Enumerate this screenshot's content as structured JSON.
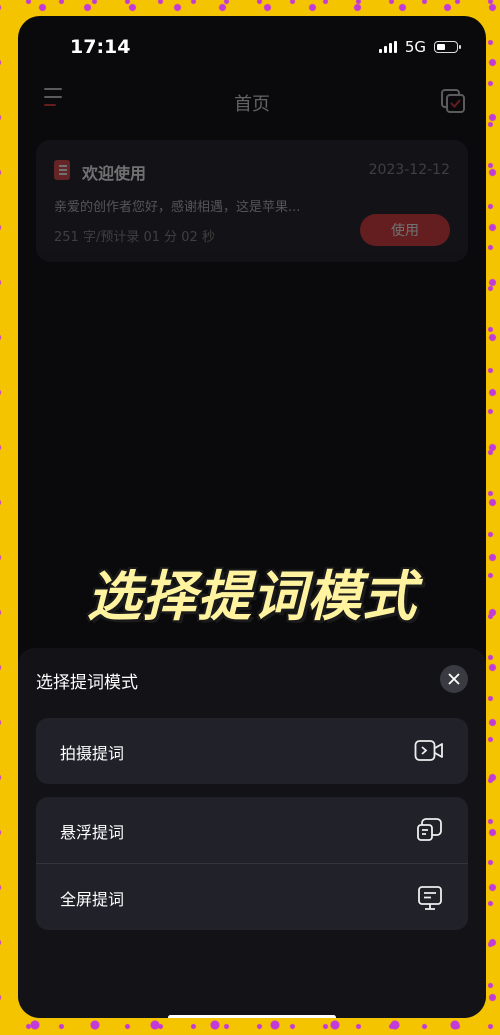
{
  "status": {
    "time": "17:14",
    "network": "5G"
  },
  "nav": {
    "title": "首页"
  },
  "card": {
    "title": "欢迎使用",
    "date": "2023-12-12",
    "description": "亲爱的创作者您好，感谢相遇，这是苹果...",
    "meta": "251 字/预计录 01 分 02 秒",
    "use_label": "使用"
  },
  "overlay": {
    "caption": "选择提词模式"
  },
  "sheet": {
    "title": "选择提词模式",
    "options": [
      {
        "label": "拍摄提词",
        "icon": "video-camera-icon"
      },
      {
        "label": "悬浮提词",
        "icon": "floating-window-icon"
      },
      {
        "label": "全屏提词",
        "icon": "monitor-text-icon"
      }
    ]
  },
  "colors": {
    "accent": "#e23a3a",
    "background_frame": "#f5c400",
    "caption": "#fff3a0"
  }
}
